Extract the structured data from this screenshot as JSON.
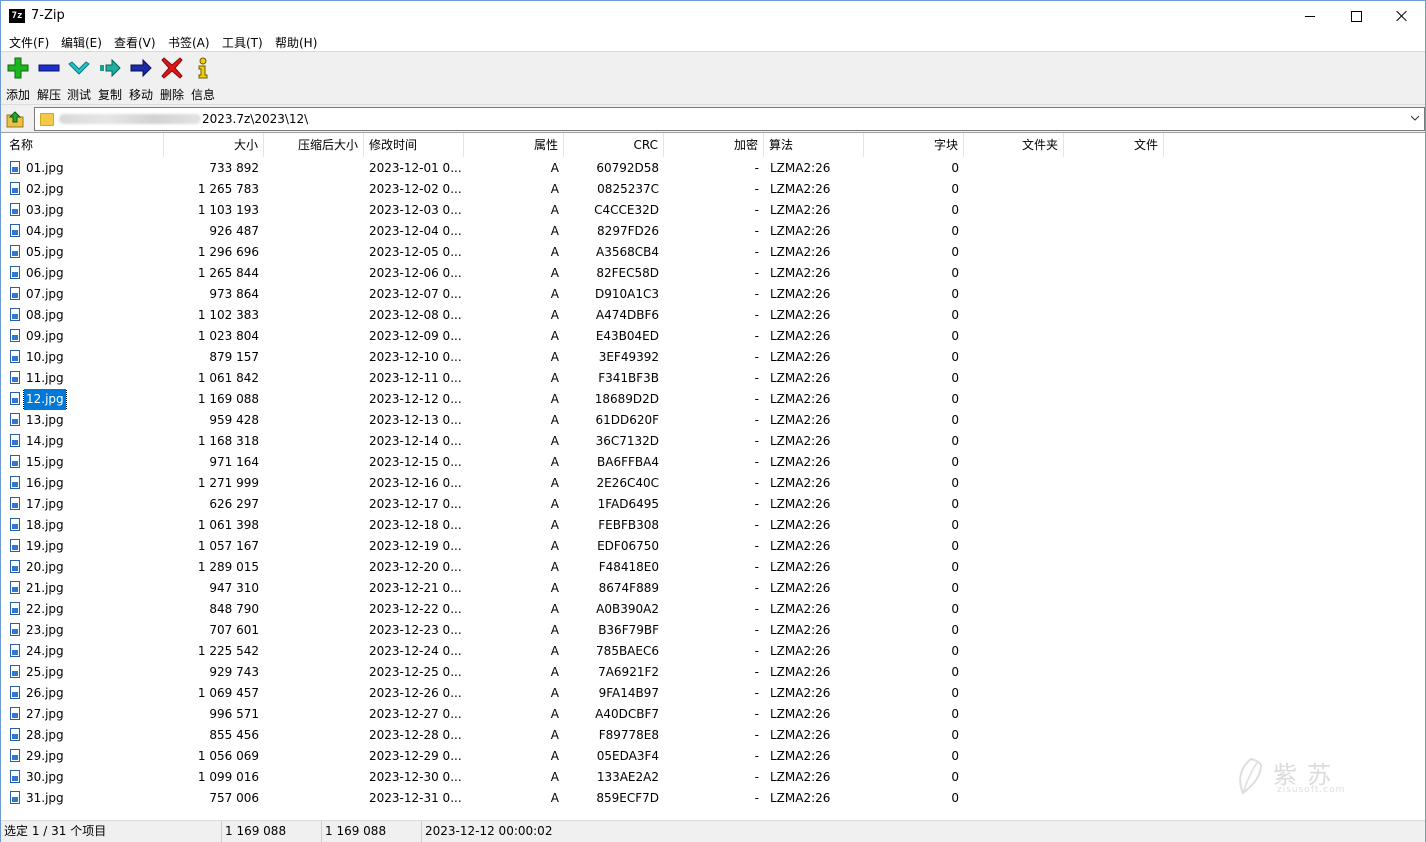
{
  "window": {
    "title": "7-Zip",
    "icon_text": "7z"
  },
  "menu": [
    "文件(F)",
    "编辑(E)",
    "查看(V)",
    "书签(A)",
    "工具(T)",
    "帮助(H)"
  ],
  "toolbar": [
    {
      "label": "添加",
      "icon": "add-plus-icon",
      "color": "#17a317"
    },
    {
      "label": "解压",
      "icon": "extract-minus-icon",
      "color": "#1c2fc8"
    },
    {
      "label": "测试",
      "icon": "test-check-icon",
      "color": "#1aa6b3"
    },
    {
      "label": "复制",
      "icon": "copy-arrow-icon",
      "color": "#1a9c90"
    },
    {
      "label": "移动",
      "icon": "move-arrow-icon",
      "color": "#1a2a9c"
    },
    {
      "label": "删除",
      "icon": "delete-x-icon",
      "color": "#e01010"
    },
    {
      "label": "信息",
      "icon": "info-i-icon",
      "color": "#e0c200"
    }
  ],
  "address": {
    "path_visible": "2023.7z\\2023\\12\\"
  },
  "columns": {
    "name": "名称",
    "size": "大小",
    "packed": "压缩后大小",
    "modified": "修改时间",
    "attributes": "属性",
    "crc": "CRC",
    "encrypted": "加密",
    "method": "算法",
    "block": "字块",
    "folders": "文件夹",
    "files": "文件"
  },
  "selected_index": 11,
  "rows": [
    {
      "name": "01.jpg",
      "size": "733 892",
      "modified": "2023-12-01 0...",
      "attr": "A",
      "crc": "60792D58",
      "enc": "-",
      "method": "LZMA2:26",
      "block": "0"
    },
    {
      "name": "02.jpg",
      "size": "1 265 783",
      "modified": "2023-12-02 0...",
      "attr": "A",
      "crc": "0825237C",
      "enc": "-",
      "method": "LZMA2:26",
      "block": "0"
    },
    {
      "name": "03.jpg",
      "size": "1 103 193",
      "modified": "2023-12-03 0...",
      "attr": "A",
      "crc": "C4CCE32D",
      "enc": "-",
      "method": "LZMA2:26",
      "block": "0"
    },
    {
      "name": "04.jpg",
      "size": "926 487",
      "modified": "2023-12-04 0...",
      "attr": "A",
      "crc": "8297FD26",
      "enc": "-",
      "method": "LZMA2:26",
      "block": "0"
    },
    {
      "name": "05.jpg",
      "size": "1 296 696",
      "modified": "2023-12-05 0...",
      "attr": "A",
      "crc": "A3568CB4",
      "enc": "-",
      "method": "LZMA2:26",
      "block": "0"
    },
    {
      "name": "06.jpg",
      "size": "1 265 844",
      "modified": "2023-12-06 0...",
      "attr": "A",
      "crc": "82FEC58D",
      "enc": "-",
      "method": "LZMA2:26",
      "block": "0"
    },
    {
      "name": "07.jpg",
      "size": "973 864",
      "modified": "2023-12-07 0...",
      "attr": "A",
      "crc": "D910A1C3",
      "enc": "-",
      "method": "LZMA2:26",
      "block": "0"
    },
    {
      "name": "08.jpg",
      "size": "1 102 383",
      "modified": "2023-12-08 0...",
      "attr": "A",
      "crc": "A474DBF6",
      "enc": "-",
      "method": "LZMA2:26",
      "block": "0"
    },
    {
      "name": "09.jpg",
      "size": "1 023 804",
      "modified": "2023-12-09 0...",
      "attr": "A",
      "crc": "E43B04ED",
      "enc": "-",
      "method": "LZMA2:26",
      "block": "0"
    },
    {
      "name": "10.jpg",
      "size": "879 157",
      "modified": "2023-12-10 0...",
      "attr": "A",
      "crc": "3EF49392",
      "enc": "-",
      "method": "LZMA2:26",
      "block": "0"
    },
    {
      "name": "11.jpg",
      "size": "1 061 842",
      "modified": "2023-12-11 0...",
      "attr": "A",
      "crc": "F341BF3B",
      "enc": "-",
      "method": "LZMA2:26",
      "block": "0"
    },
    {
      "name": "12.jpg",
      "size": "1 169 088",
      "modified": "2023-12-12 0...",
      "attr": "A",
      "crc": "18689D2D",
      "enc": "-",
      "method": "LZMA2:26",
      "block": "0"
    },
    {
      "name": "13.jpg",
      "size": "959 428",
      "modified": "2023-12-13 0...",
      "attr": "A",
      "crc": "61DD620F",
      "enc": "-",
      "method": "LZMA2:26",
      "block": "0"
    },
    {
      "name": "14.jpg",
      "size": "1 168 318",
      "modified": "2023-12-14 0...",
      "attr": "A",
      "crc": "36C7132D",
      "enc": "-",
      "method": "LZMA2:26",
      "block": "0"
    },
    {
      "name": "15.jpg",
      "size": "971 164",
      "modified": "2023-12-15 0...",
      "attr": "A",
      "crc": "BA6FFBA4",
      "enc": "-",
      "method": "LZMA2:26",
      "block": "0"
    },
    {
      "name": "16.jpg",
      "size": "1 271 999",
      "modified": "2023-12-16 0...",
      "attr": "A",
      "crc": "2E26C40C",
      "enc": "-",
      "method": "LZMA2:26",
      "block": "0"
    },
    {
      "name": "17.jpg",
      "size": "626 297",
      "modified": "2023-12-17 0...",
      "attr": "A",
      "crc": "1FAD6495",
      "enc": "-",
      "method": "LZMA2:26",
      "block": "0"
    },
    {
      "name": "18.jpg",
      "size": "1 061 398",
      "modified": "2023-12-18 0...",
      "attr": "A",
      "crc": "FEBFB308",
      "enc": "-",
      "method": "LZMA2:26",
      "block": "0"
    },
    {
      "name": "19.jpg",
      "size": "1 057 167",
      "modified": "2023-12-19 0...",
      "attr": "A",
      "crc": "EDF06750",
      "enc": "-",
      "method": "LZMA2:26",
      "block": "0"
    },
    {
      "name": "20.jpg",
      "size": "1 289 015",
      "modified": "2023-12-20 0...",
      "attr": "A",
      "crc": "F48418E0",
      "enc": "-",
      "method": "LZMA2:26",
      "block": "0"
    },
    {
      "name": "21.jpg",
      "size": "947 310",
      "modified": "2023-12-21 0...",
      "attr": "A",
      "crc": "8674F889",
      "enc": "-",
      "method": "LZMA2:26",
      "block": "0"
    },
    {
      "name": "22.jpg",
      "size": "848 790",
      "modified": "2023-12-22 0...",
      "attr": "A",
      "crc": "A0B390A2",
      "enc": "-",
      "method": "LZMA2:26",
      "block": "0"
    },
    {
      "name": "23.jpg",
      "size": "707 601",
      "modified": "2023-12-23 0...",
      "attr": "A",
      "crc": "B36F79BF",
      "enc": "-",
      "method": "LZMA2:26",
      "block": "0"
    },
    {
      "name": "24.jpg",
      "size": "1 225 542",
      "modified": "2023-12-24 0...",
      "attr": "A",
      "crc": "785BAEC6",
      "enc": "-",
      "method": "LZMA2:26",
      "block": "0"
    },
    {
      "name": "25.jpg",
      "size": "929 743",
      "modified": "2023-12-25 0...",
      "attr": "A",
      "crc": "7A6921F2",
      "enc": "-",
      "method": "LZMA2:26",
      "block": "0"
    },
    {
      "name": "26.jpg",
      "size": "1 069 457",
      "modified": "2023-12-26 0...",
      "attr": "A",
      "crc": "9FA14B97",
      "enc": "-",
      "method": "LZMA2:26",
      "block": "0"
    },
    {
      "name": "27.jpg",
      "size": "996 571",
      "modified": "2023-12-27 0...",
      "attr": "A",
      "crc": "A40DCBF7",
      "enc": "-",
      "method": "LZMA2:26",
      "block": "0"
    },
    {
      "name": "28.jpg",
      "size": "855 456",
      "modified": "2023-12-28 0...",
      "attr": "A",
      "crc": "F89778E8",
      "enc": "-",
      "method": "LZMA2:26",
      "block": "0"
    },
    {
      "name": "29.jpg",
      "size": "1 056 069",
      "modified": "2023-12-29 0...",
      "attr": "A",
      "crc": "05EDA3F4",
      "enc": "-",
      "method": "LZMA2:26",
      "block": "0"
    },
    {
      "name": "30.jpg",
      "size": "1 099 016",
      "modified": "2023-12-30 0...",
      "attr": "A",
      "crc": "133AE2A2",
      "enc": "-",
      "method": "LZMA2:26",
      "block": "0"
    },
    {
      "name": "31.jpg",
      "size": "757 006",
      "modified": "2023-12-31 0...",
      "attr": "A",
      "crc": "859ECF7D",
      "enc": "-",
      "method": "LZMA2:26",
      "block": "0"
    }
  ],
  "status": {
    "selection": "选定 1 / 31 个项目",
    "size": "1 169 088",
    "packed": "1 169 088",
    "modified": "2023-12-12 00:00:02"
  },
  "watermark": {
    "big": "紫苏",
    "small": "zisusoft.com"
  }
}
